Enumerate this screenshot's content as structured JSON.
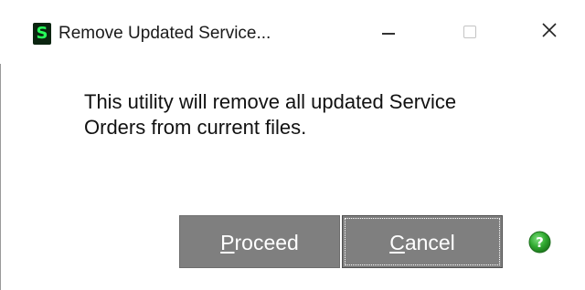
{
  "window": {
    "title": "Remove Updated Service...",
    "app_icon_letter": "S",
    "controls": {
      "minimize": "minimize",
      "maximize": "maximize",
      "close": "close"
    }
  },
  "message": {
    "line1": "This utility will remove all updated Service",
    "line2": "Orders from current files."
  },
  "buttons": {
    "proceed": {
      "mnemonic": "P",
      "rest": "roceed"
    },
    "cancel": {
      "mnemonic": "C",
      "rest": "ancel"
    }
  },
  "icons": {
    "app": "sage-s-icon",
    "help": "help-icon"
  },
  "colors": {
    "button_bg": "#7f7f7f",
    "button_text": "#ffffff",
    "help_green": "#2fa82f",
    "app_icon_bg": "#0b2410",
    "app_icon_fg": "#27ff5a"
  }
}
